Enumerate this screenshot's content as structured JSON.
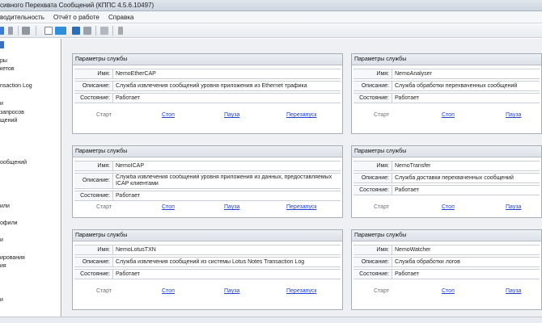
{
  "window": {
    "title": "сивного Перехвата Сообщений (КППС 4.5.6.10497)"
  },
  "menu": {
    "items": [
      "водительность",
      "Отчёт о работе",
      "Справка"
    ]
  },
  "toolbar": {
    "icons": [
      "arrow-icon",
      "pause-icon",
      "grid-icon",
      "document-icon",
      "refresh-icon",
      "save-icon",
      "disk-icon",
      "table-icon",
      "filter-icon"
    ]
  },
  "sidebar": {
    "items": [
      "ры",
      "кетов",
      "nsaction Log",
      "и",
      "запросов",
      "щений",
      "ообщений",
      "или",
      "офили",
      "и",
      "ирования",
      "ия",
      "и"
    ]
  },
  "panel_header": "Параметры службы",
  "field_labels": {
    "name": "Имя:",
    "description": "Описание:",
    "state": "Состояние:"
  },
  "actions": {
    "start": "Старт",
    "stop": "Стоп",
    "pause": "Пауза",
    "restart": "Перезапуск"
  },
  "services": [
    {
      "name": "NemoEtherCAP",
      "description": "Служба извлечения сообщений уровня приложения из Ethernet трафика",
      "state": "Работает"
    },
    {
      "name": "NemoAnalyser",
      "description": "Служба обработки перехваченных сообщений",
      "state": "Работает"
    },
    {
      "name": "NemoICAP",
      "description": "Служба извлечения сообщений уровня приложения из данных, предоставляемых ICAP клиентами",
      "state": "Работает"
    },
    {
      "name": "NemoTransfer",
      "description": "Служба доставки перехваченных сообщений",
      "state": "Работает"
    },
    {
      "name": "NemoLotusTXN",
      "description": "Служба извлечения сообщений из системы Lotus Notes Transaction Log",
      "state": "Работает"
    },
    {
      "name": "NemoWatcher",
      "description": "Служба обработки логов",
      "state": "Работает"
    }
  ]
}
